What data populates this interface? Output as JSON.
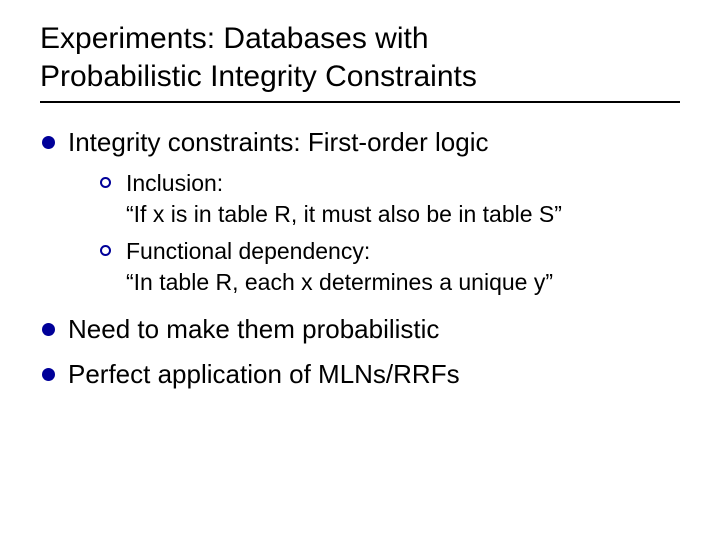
{
  "title_line1": "Experiments: Databases with",
  "title_line2": "Probabilistic Integrity Constraints",
  "bullets": {
    "b1": "Integrity constraints: First-order logic",
    "b1_sub1_a": "Inclusion:",
    "b1_sub1_b": "“If x is in table R, it must also be in table S”",
    "b1_sub2_a": "Functional dependency:",
    "b1_sub2_b": "“In table R, each x determines a unique y”",
    "b2": "Need to make them probabilistic",
    "b3": "Perfect application of MLNs/RRFs"
  }
}
